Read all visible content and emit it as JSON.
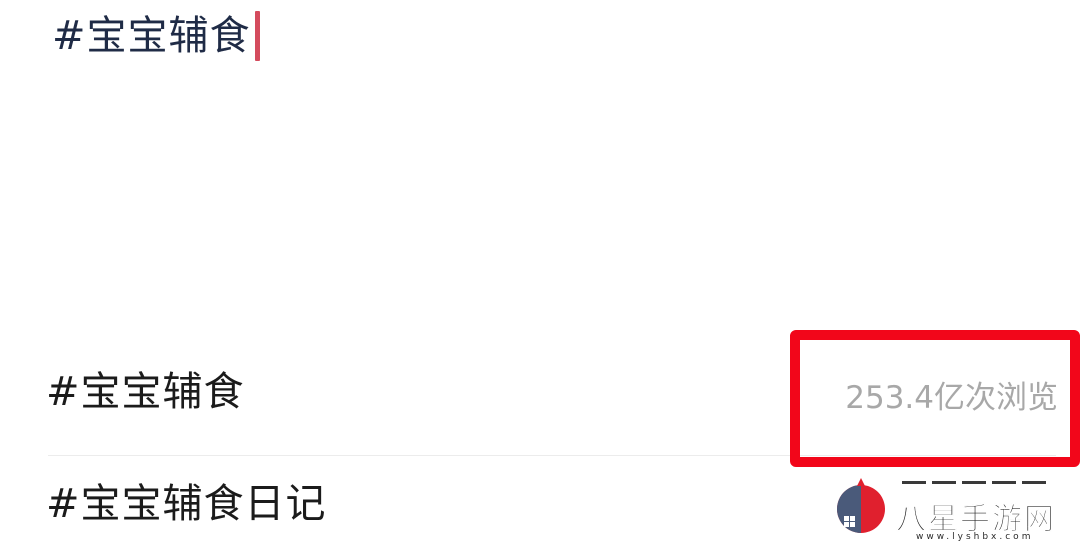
{
  "compose": {
    "input_value": "#宝宝辅食"
  },
  "suggestions": [
    {
      "label": "#宝宝辅食",
      "stat": "253.4亿次浏览"
    },
    {
      "label": "#宝宝辅食日记",
      "stat": ""
    }
  ],
  "watermark": {
    "title": "八星手游网",
    "url": "www.lyshbx.com"
  },
  "colors": {
    "caret": "#d44b5d",
    "highlight": "#f2061a",
    "text_primary": "#1b1b1b",
    "text_secondary": "#a8a8a8"
  }
}
